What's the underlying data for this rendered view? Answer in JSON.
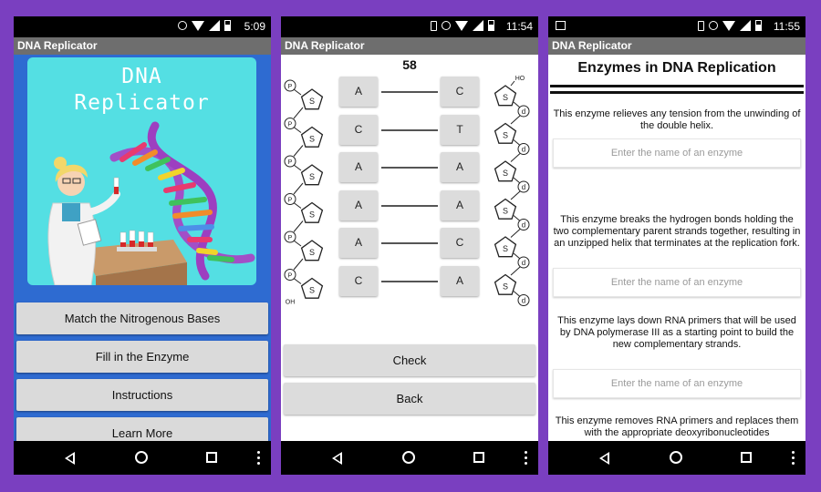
{
  "phones": [
    {
      "status": {
        "time": "5:09"
      },
      "appbar": {
        "title": "DNA Replicator"
      },
      "hero": {
        "title_line1": "DNA",
        "title_line2": "Replicator"
      },
      "menu": [
        {
          "label": "Match the Nitrogenous Bases"
        },
        {
          "label": "Fill in the Enzyme"
        },
        {
          "label": "Instructions"
        },
        {
          "label": "Learn More"
        }
      ]
    },
    {
      "status": {
        "time": "11:54"
      },
      "appbar": {
        "title": "DNA Replicator"
      },
      "score": "58",
      "pairs": [
        {
          "left": "A",
          "right": "C"
        },
        {
          "left": "C",
          "right": "T"
        },
        {
          "left": "A",
          "right": "A"
        },
        {
          "left": "A",
          "right": "A"
        },
        {
          "left": "A",
          "right": "C"
        },
        {
          "left": "C",
          "right": "A"
        }
      ],
      "strand_labels": {
        "phosphate": "P",
        "sugar": "S",
        "deoxy": "d",
        "hydroxyl_left": "OH",
        "hydroxyl_right": "HO"
      },
      "buttons": {
        "check": "Check",
        "back": "Back"
      }
    },
    {
      "status": {
        "time": "11:55"
      },
      "appbar": {
        "title": "DNA Replicator"
      },
      "title": "Enzymes in DNA Replication",
      "questions": [
        {
          "text": "This enzyme relieves any tension from the unwinding of the double helix.",
          "placeholder": "Enter the name of an enzyme"
        },
        {
          "text": "This enzyme breaks the hydrogen bonds holding the two complementary parent strands together, resulting in an unzipped helix that terminates at the replication fork.",
          "placeholder": "Enter the name of an enzyme"
        },
        {
          "text": "This enzyme lays down RNA primers that will be used by DNA polymerase III as a starting point to build the new complementary strands.",
          "placeholder": "Enter the name of an enzyme"
        },
        {
          "text": "This enzyme removes RNA primers and replaces them with the appropriate deoxyribonucleotides"
        }
      ]
    }
  ]
}
